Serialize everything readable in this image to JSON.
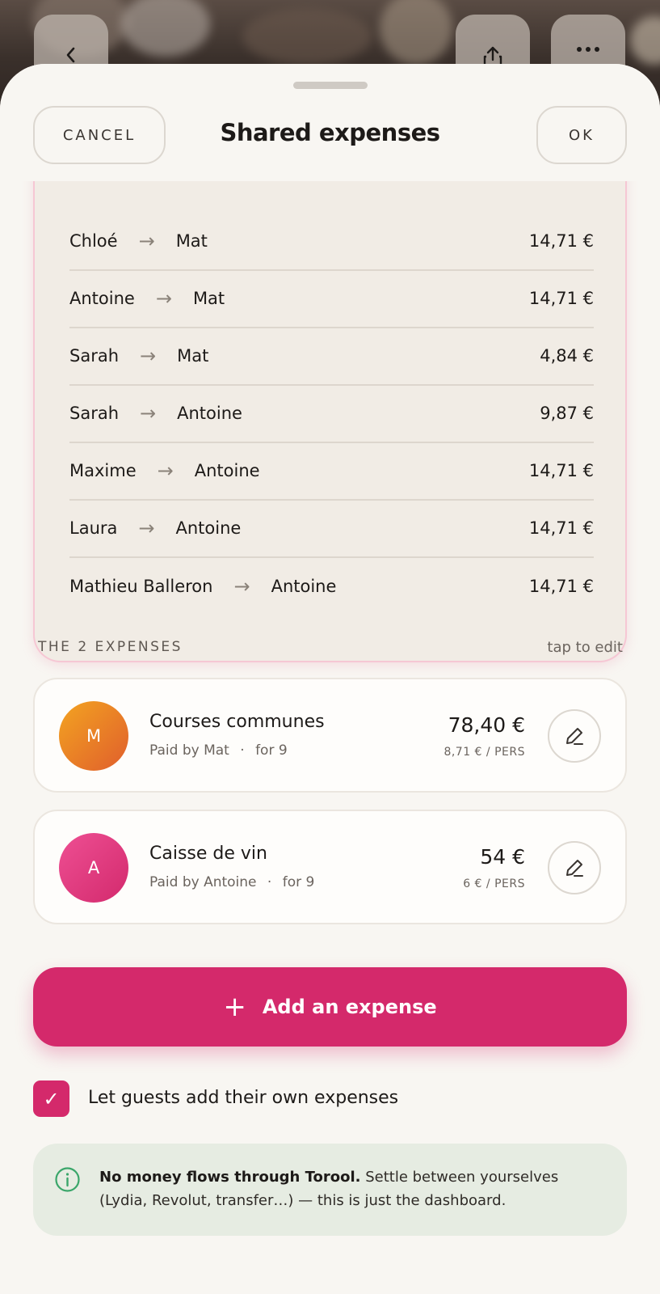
{
  "nav": {
    "back_icon": "chevron-left-icon",
    "share_icon": "share-icon",
    "more_icon": "more-dots-icon"
  },
  "header": {
    "cancel_label": "CANCEL",
    "title": "Shared expenses",
    "ok_label": "OK"
  },
  "transfers": [
    {
      "from": "Chloé",
      "to": "Mat",
      "amount": "14,71 €"
    },
    {
      "from": "Antoine",
      "to": "Mat",
      "amount": "14,71 €"
    },
    {
      "from": "Sarah",
      "to": "Mat",
      "amount": "4,84 €"
    },
    {
      "from": "Sarah",
      "to": "Antoine",
      "amount": "9,87 €"
    },
    {
      "from": "Maxime",
      "to": "Antoine",
      "amount": "14,71 €"
    },
    {
      "from": "Laura",
      "to": "Antoine",
      "amount": "14,71 €"
    },
    {
      "from": "Mathieu Balleron",
      "to": "Antoine",
      "amount": "14,71 €"
    }
  ],
  "expenses_section": {
    "label": "THE 2 EXPENSES",
    "hint": "tap to edit"
  },
  "expenses": [
    {
      "initial": "M",
      "name": "Courses communes",
      "paid_by": "Paid by Mat",
      "for": "for 9",
      "amount": "78,40 €",
      "per_person": "8,71 € / PERS",
      "avatar_color": "#ef8a24"
    },
    {
      "initial": "A",
      "name": "Caisse de vin",
      "paid_by": "Paid by Antoine",
      "for": "for 9",
      "amount": "54 €",
      "per_person": "6 € / PERS",
      "avatar_color": "#e03a82"
    }
  ],
  "add_button": {
    "label": "Add an expense"
  },
  "guests_option": {
    "label": "Let guests add their own expenses",
    "checked": true
  },
  "info": {
    "bold": "No money flows through Torool.",
    "text": " Settle between yourselves (Lydia, Revolut, transfer…) — this is just the dashboard."
  },
  "colors": {
    "accent": "#d4296b",
    "sheet": "#f8f6f2",
    "card": "#f1ece5",
    "info_bg": "#e6ece2"
  }
}
